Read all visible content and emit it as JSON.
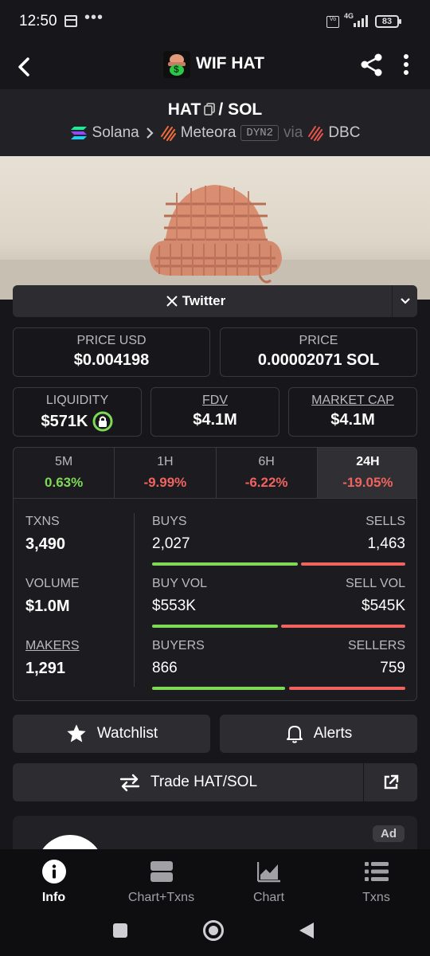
{
  "status_bar": {
    "time": "12:50",
    "dots": "•••",
    "network": "4G",
    "battery": "83"
  },
  "header": {
    "title": "WIF HAT",
    "logo_glyph": "$"
  },
  "pair": {
    "base": "HAT",
    "separator": "/",
    "quote": "SOL",
    "chain": "Solana",
    "dex": "Meteora",
    "dex_tag": "DYN2",
    "via_label": "via",
    "via": "DBC"
  },
  "socials": {
    "twitter_label": "Twitter"
  },
  "prices": {
    "price_usd_label": "PRICE USD",
    "price_usd": "$0.004198",
    "price_label": "PRICE",
    "price_native": "0.00002071 SOL"
  },
  "metrics": {
    "liquidity_label": "LIQUIDITY",
    "liquidity": "$571K",
    "fdv_label": "FDV",
    "fdv": "$4.1M",
    "mcap_label": "MARKET CAP",
    "mcap": "$4.1M"
  },
  "timeframes": [
    {
      "label": "5M",
      "change": "0.63%",
      "dir": "up"
    },
    {
      "label": "1H",
      "change": "-9.99%",
      "dir": "down"
    },
    {
      "label": "6H",
      "change": "-6.22%",
      "dir": "down"
    },
    {
      "label": "24H",
      "change": "-19.05%",
      "dir": "down"
    }
  ],
  "stats": {
    "txns_label": "TXNS",
    "txns": "3,490",
    "volume_label": "VOLUME",
    "volume": "$1.0M",
    "makers_label": "MAKERS",
    "makers": "1,291",
    "buys_label": "BUYS",
    "buys": "2,027",
    "sells_label": "SELLS",
    "sells": "1,463",
    "buys_fraction": 0.581,
    "buy_vol_label": "BUY VOL",
    "buy_vol": "$553K",
    "sell_vol_label": "SELL VOL",
    "sell_vol": "$545K",
    "buy_vol_fraction": 0.504,
    "buyers_label": "BUYERS",
    "buyers": "866",
    "sellers_label": "SELLERS",
    "sellers": "759",
    "buyers_fraction": 0.533
  },
  "actions": {
    "watchlist": "Watchlist",
    "alerts": "Alerts",
    "trade": "Trade HAT/SOL"
  },
  "ad": {
    "badge": "Ad"
  },
  "bottom_nav": [
    {
      "label": "Info",
      "icon": "info-icon",
      "active": true
    },
    {
      "label": "Chart+Txns",
      "icon": "split-view-icon",
      "active": false
    },
    {
      "label": "Chart",
      "icon": "chart-icon",
      "active": false
    },
    {
      "label": "Txns",
      "icon": "list-icon",
      "active": false
    }
  ],
  "colors": {
    "positive": "#7ed957",
    "negative": "#f0635f",
    "background": "#17171b"
  }
}
